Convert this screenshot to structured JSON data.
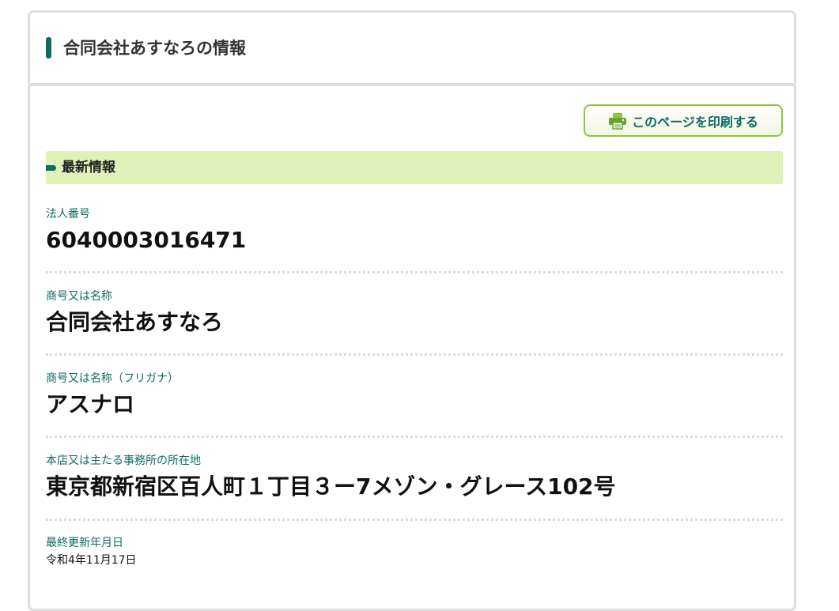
{
  "header": {
    "title": "合同会社あすなろの情報"
  },
  "toolbar": {
    "print_label": "このページを印刷する",
    "print_icon": "printer-icon"
  },
  "section": {
    "title": "最新情報"
  },
  "fields": [
    {
      "label": "法人番号",
      "value": "6040003016471"
    },
    {
      "label": "商号又は名称",
      "value": "合同会社あすなろ"
    },
    {
      "label": "商号又は名称（フリガナ）",
      "value": "アスナロ"
    },
    {
      "label": "本店又は主たる事務所の所在地",
      "value": "東京都新宿区百人町１丁目３ー7メゾン・グレース102号"
    },
    {
      "label": "最終更新年月日",
      "value": "令和4年11月17日"
    }
  ],
  "colors": {
    "accent": "#0c6b5e",
    "section_bg": "#dff0b8",
    "button_border": "#8dc63f"
  }
}
